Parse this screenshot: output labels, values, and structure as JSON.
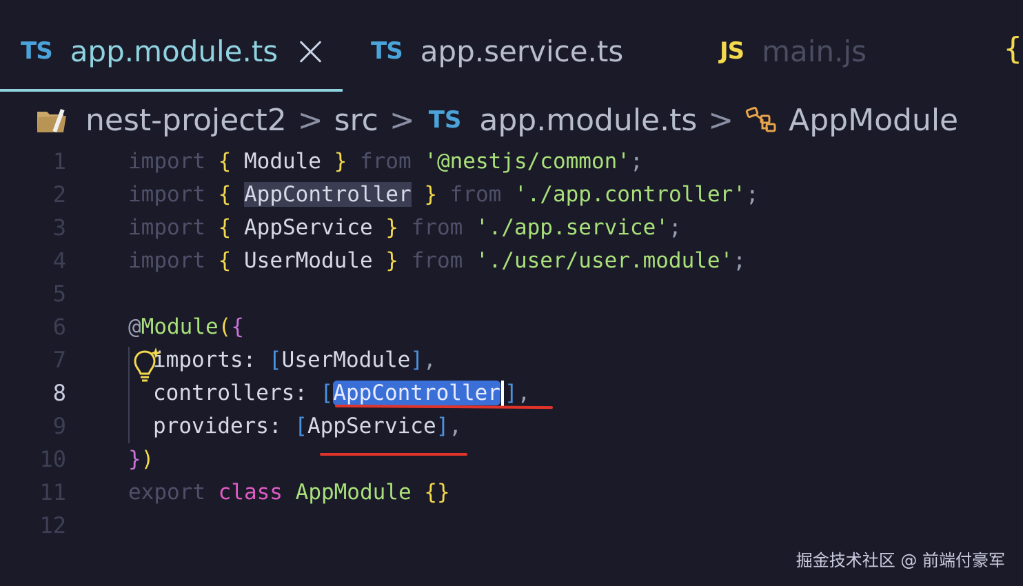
{
  "tabs": [
    {
      "badge": "TS",
      "name": "app.module.ts"
    },
    {
      "badge": "TS",
      "name": "app.service.ts"
    },
    {
      "badge": "JS",
      "name": "main.js"
    },
    {
      "badge": "{",
      "name": ""
    }
  ],
  "breadcrumb": {
    "project": "nest-project2",
    "sep": ">",
    "folder": "src",
    "file_badge": "TS",
    "file": "app.module.ts",
    "symbol": "AppModule"
  },
  "editor": {
    "line_numbers": [
      "1",
      "2",
      "3",
      "4",
      "5",
      "6",
      "7",
      "8",
      "9",
      "10",
      "11",
      "12"
    ],
    "active_line": "8",
    "lines": {
      "l1": {
        "import": "import",
        "ob": "{",
        "name": " Module ",
        "cb": "}",
        "from": "from",
        "str": "'@nestjs/common'",
        "semi": ";"
      },
      "l2": {
        "import": "import",
        "ob": "{",
        "name_hl": "AppController",
        "cb": "}",
        "from": "from",
        "str": "'./app.controller'",
        "semi": ";"
      },
      "l3": {
        "import": "import",
        "ob": "{",
        "name": " AppService ",
        "cb": "}",
        "from": "from",
        "str": "'./app.service'",
        "semi": ";"
      },
      "l4": {
        "import": "import",
        "ob": "{",
        "name": " UserModule ",
        "cb": "}",
        "from": "from",
        "str": "'./user/user.module'",
        "semi": ";"
      },
      "l6": {
        "at": "@",
        "deco": "Module",
        "op": "(",
        "ob": "{"
      },
      "l7": {
        "prop": "imports:",
        "lb": "[",
        "val": "UserModule",
        "rb": "]",
        "comma": ","
      },
      "l8": {
        "prop": "controllers:",
        "lb": "[",
        "val_sel": "AppController",
        "rb": "]",
        "comma": ","
      },
      "l9": {
        "prop": "providers:",
        "lb": "[",
        "val": "AppService",
        "rb": "]",
        "comma": ","
      },
      "l10": {
        "cb": "}",
        "cp": ")"
      },
      "l11": {
        "export": "export",
        "class": "class",
        "name": "AppModule",
        "braces": "{}"
      }
    }
  },
  "watermark": "掘金技术社区 @ 前端付豪军",
  "colors": {
    "background": "#1b1a28",
    "ts_badge": "#4aa3d9",
    "js_badge": "#f2d94e",
    "string": "#a8e07a",
    "selection": "#3a6fd8",
    "annotation_red": "#e0342b"
  }
}
